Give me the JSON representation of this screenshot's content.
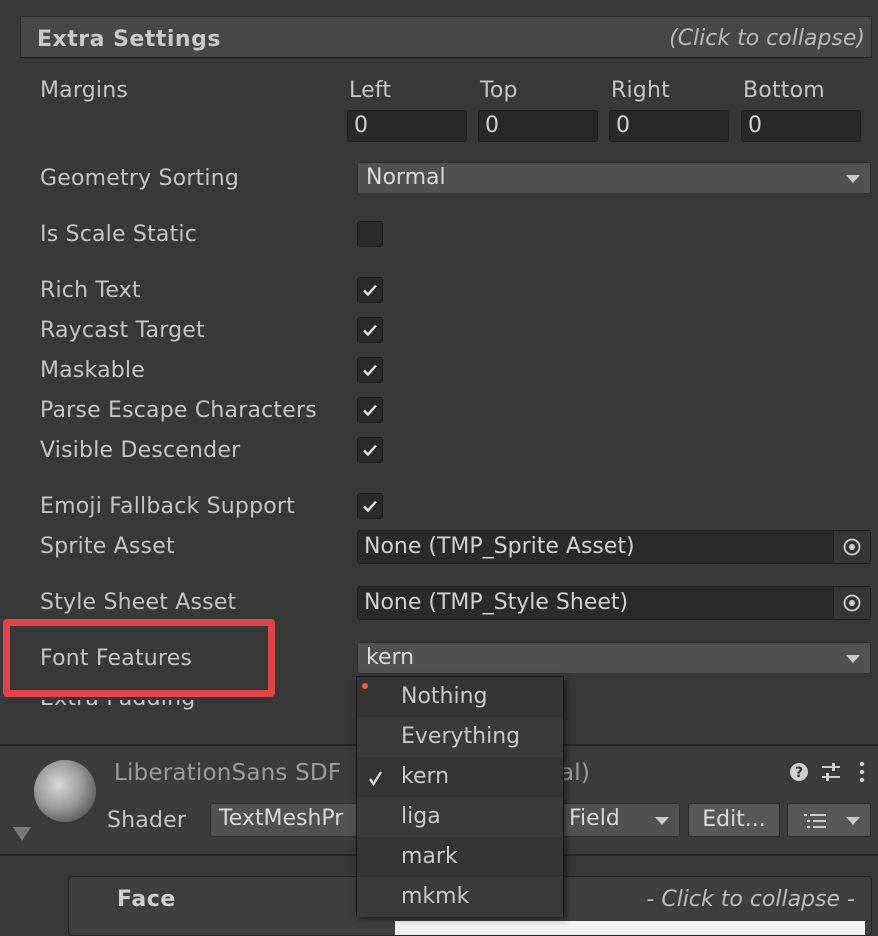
{
  "section": {
    "title": "Extra Settings",
    "hint": "(Click to collapse)"
  },
  "margins": {
    "label": "Margins",
    "columns": [
      {
        "label": "Left",
        "value": "0"
      },
      {
        "label": "Top",
        "value": "0"
      },
      {
        "label": "Right",
        "value": "0"
      },
      {
        "label": "Bottom",
        "value": "0"
      }
    ]
  },
  "geometry_sorting": {
    "label": "Geometry Sorting",
    "value": "Normal"
  },
  "is_scale_static": {
    "label": "Is Scale Static",
    "checked": false
  },
  "toggles": [
    {
      "label": "Rich Text",
      "checked": true
    },
    {
      "label": "Raycast Target",
      "checked": true
    },
    {
      "label": "Maskable",
      "checked": true
    },
    {
      "label": "Parse Escape Characters",
      "checked": true
    },
    {
      "label": "Visible Descender",
      "checked": true
    }
  ],
  "emoji_fallback": {
    "label": "Emoji Fallback Support",
    "checked": true
  },
  "sprite_asset": {
    "label": "Sprite Asset",
    "value": "None (TMP_Sprite Asset)"
  },
  "style_sheet": {
    "label": "Style Sheet Asset",
    "value": "None (TMP_Style Sheet)"
  },
  "font_features": {
    "label": "Font Features",
    "value": "kern"
  },
  "extra_padding": {
    "label": "Extra Padding"
  },
  "material": {
    "name_visible": "LiberationSans SDF",
    "name_suffix": "al)",
    "shader_label": "Shader",
    "shader_value_left": "TextMeshPr",
    "shader_value_right": "Field",
    "edit_label": "Edit..."
  },
  "face": {
    "title": "Face",
    "hint": "- Click to collapse -"
  },
  "popup": {
    "items": [
      {
        "label": "Nothing",
        "checked": false
      },
      {
        "label": "Everything",
        "checked": false
      },
      {
        "label": "kern",
        "checked": true
      },
      {
        "label": "liga",
        "checked": false
      },
      {
        "label": "mark",
        "checked": false
      },
      {
        "label": "mkmk",
        "checked": false
      }
    ]
  },
  "colors": {
    "highlight": "#e0434a",
    "accent_dot": "#d9634d"
  }
}
